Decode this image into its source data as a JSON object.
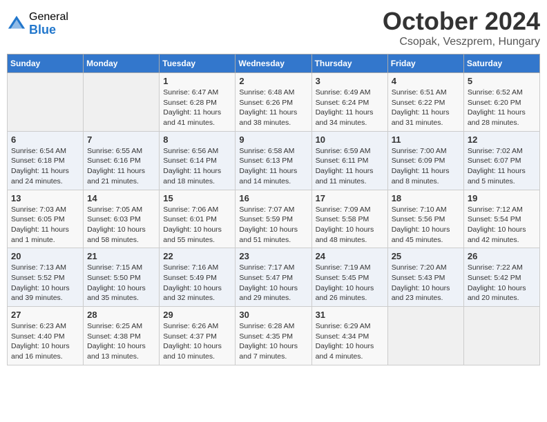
{
  "logo": {
    "general": "General",
    "blue": "Blue"
  },
  "title": "October 2024",
  "subtitle": "Csopak, Veszprem, Hungary",
  "days_of_week": [
    "Sunday",
    "Monday",
    "Tuesday",
    "Wednesday",
    "Thursday",
    "Friday",
    "Saturday"
  ],
  "weeks": [
    [
      {
        "day": "",
        "info": ""
      },
      {
        "day": "",
        "info": ""
      },
      {
        "day": "1",
        "sunrise": "6:47 AM",
        "sunset": "6:28 PM",
        "daylight": "11 hours and 41 minutes."
      },
      {
        "day": "2",
        "sunrise": "6:48 AM",
        "sunset": "6:26 PM",
        "daylight": "11 hours and 38 minutes."
      },
      {
        "day": "3",
        "sunrise": "6:49 AM",
        "sunset": "6:24 PM",
        "daylight": "11 hours and 34 minutes."
      },
      {
        "day": "4",
        "sunrise": "6:51 AM",
        "sunset": "6:22 PM",
        "daylight": "11 hours and 31 minutes."
      },
      {
        "day": "5",
        "sunrise": "6:52 AM",
        "sunset": "6:20 PM",
        "daylight": "11 hours and 28 minutes."
      }
    ],
    [
      {
        "day": "6",
        "sunrise": "6:54 AM",
        "sunset": "6:18 PM",
        "daylight": "11 hours and 24 minutes."
      },
      {
        "day": "7",
        "sunrise": "6:55 AM",
        "sunset": "6:16 PM",
        "daylight": "11 hours and 21 minutes."
      },
      {
        "day": "8",
        "sunrise": "6:56 AM",
        "sunset": "6:14 PM",
        "daylight": "11 hours and 18 minutes."
      },
      {
        "day": "9",
        "sunrise": "6:58 AM",
        "sunset": "6:13 PM",
        "daylight": "11 hours and 14 minutes."
      },
      {
        "day": "10",
        "sunrise": "6:59 AM",
        "sunset": "6:11 PM",
        "daylight": "11 hours and 11 minutes."
      },
      {
        "day": "11",
        "sunrise": "7:00 AM",
        "sunset": "6:09 PM",
        "daylight": "11 hours and 8 minutes."
      },
      {
        "day": "12",
        "sunrise": "7:02 AM",
        "sunset": "6:07 PM",
        "daylight": "11 hours and 5 minutes."
      }
    ],
    [
      {
        "day": "13",
        "sunrise": "7:03 AM",
        "sunset": "6:05 PM",
        "daylight": "11 hours and 1 minute."
      },
      {
        "day": "14",
        "sunrise": "7:05 AM",
        "sunset": "6:03 PM",
        "daylight": "10 hours and 58 minutes."
      },
      {
        "day": "15",
        "sunrise": "7:06 AM",
        "sunset": "6:01 PM",
        "daylight": "10 hours and 55 minutes."
      },
      {
        "day": "16",
        "sunrise": "7:07 AM",
        "sunset": "5:59 PM",
        "daylight": "10 hours and 51 minutes."
      },
      {
        "day": "17",
        "sunrise": "7:09 AM",
        "sunset": "5:58 PM",
        "daylight": "10 hours and 48 minutes."
      },
      {
        "day": "18",
        "sunrise": "7:10 AM",
        "sunset": "5:56 PM",
        "daylight": "10 hours and 45 minutes."
      },
      {
        "day": "19",
        "sunrise": "7:12 AM",
        "sunset": "5:54 PM",
        "daylight": "10 hours and 42 minutes."
      }
    ],
    [
      {
        "day": "20",
        "sunrise": "7:13 AM",
        "sunset": "5:52 PM",
        "daylight": "10 hours and 39 minutes."
      },
      {
        "day": "21",
        "sunrise": "7:15 AM",
        "sunset": "5:50 PM",
        "daylight": "10 hours and 35 minutes."
      },
      {
        "day": "22",
        "sunrise": "7:16 AM",
        "sunset": "5:49 PM",
        "daylight": "10 hours and 32 minutes."
      },
      {
        "day": "23",
        "sunrise": "7:17 AM",
        "sunset": "5:47 PM",
        "daylight": "10 hours and 29 minutes."
      },
      {
        "day": "24",
        "sunrise": "7:19 AM",
        "sunset": "5:45 PM",
        "daylight": "10 hours and 26 minutes."
      },
      {
        "day": "25",
        "sunrise": "7:20 AM",
        "sunset": "5:43 PM",
        "daylight": "10 hours and 23 minutes."
      },
      {
        "day": "26",
        "sunrise": "7:22 AM",
        "sunset": "5:42 PM",
        "daylight": "10 hours and 20 minutes."
      }
    ],
    [
      {
        "day": "27",
        "sunrise": "6:23 AM",
        "sunset": "4:40 PM",
        "daylight": "10 hours and 16 minutes."
      },
      {
        "day": "28",
        "sunrise": "6:25 AM",
        "sunset": "4:38 PM",
        "daylight": "10 hours and 13 minutes."
      },
      {
        "day": "29",
        "sunrise": "6:26 AM",
        "sunset": "4:37 PM",
        "daylight": "10 hours and 10 minutes."
      },
      {
        "day": "30",
        "sunrise": "6:28 AM",
        "sunset": "4:35 PM",
        "daylight": "10 hours and 7 minutes."
      },
      {
        "day": "31",
        "sunrise": "6:29 AM",
        "sunset": "4:34 PM",
        "daylight": "10 hours and 4 minutes."
      },
      {
        "day": "",
        "info": ""
      },
      {
        "day": "",
        "info": ""
      }
    ]
  ]
}
